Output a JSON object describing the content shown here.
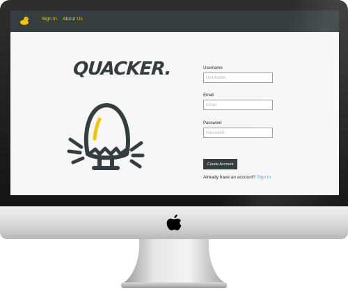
{
  "navbar": {
    "logo_icon": "duck-icon",
    "links": [
      {
        "label": "Sign In"
      },
      {
        "label": "About Us"
      }
    ]
  },
  "hero": {
    "brand": "QUACKER.",
    "illustration_icon": "hatching-egg-icon"
  },
  "form": {
    "username": {
      "label": "Username",
      "placeholder": "Username",
      "value": ""
    },
    "email": {
      "label": "Email",
      "placeholder": "Email",
      "value": ""
    },
    "password": {
      "label": "Password",
      "placeholder": "Password",
      "value": ""
    },
    "submit_label": "Create Account",
    "account_prompt": "Already have an account?",
    "account_link": "Sign In"
  },
  "device": {
    "logo_icon": "apple-icon"
  },
  "colors": {
    "navbar": "#353d40",
    "accent": "#f1c40f",
    "link": "#3ca0e0",
    "button": "#353d40"
  }
}
